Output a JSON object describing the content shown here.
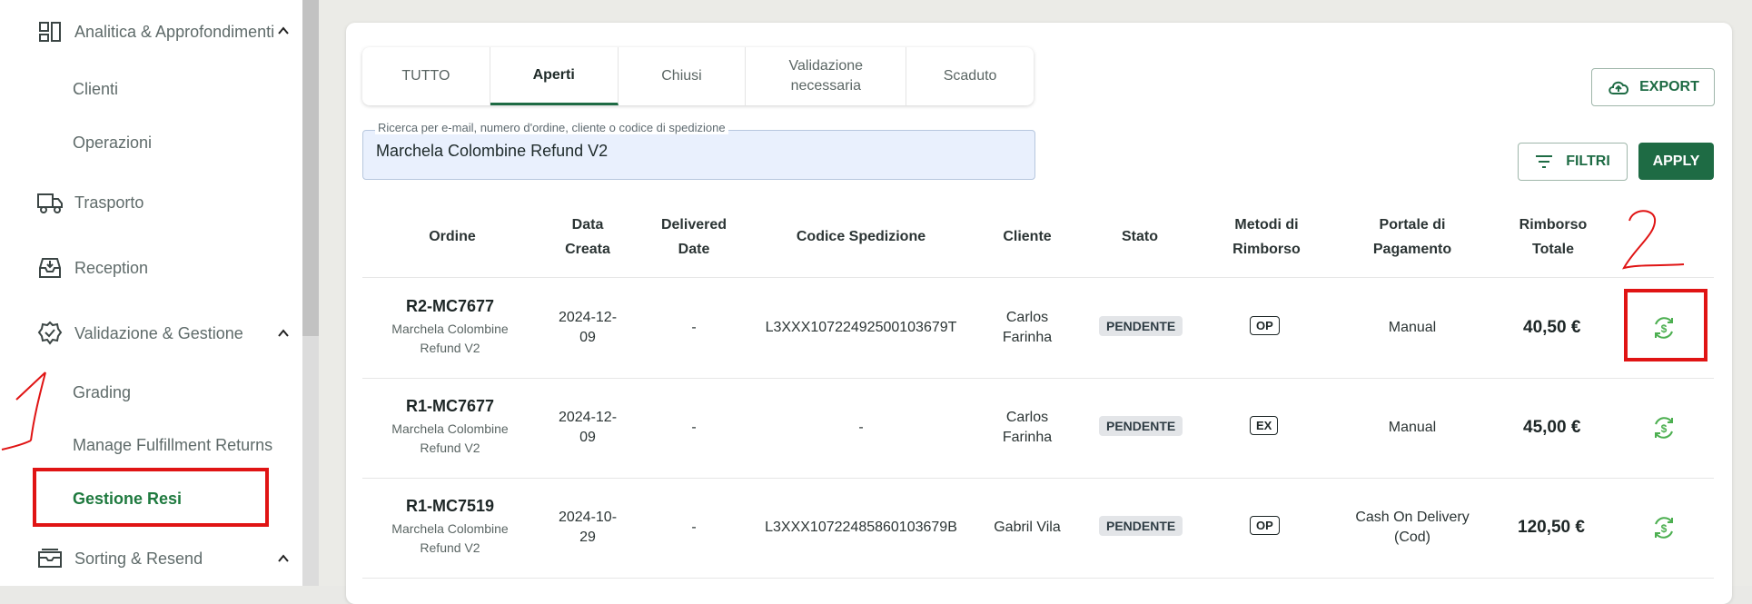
{
  "sidebar": {
    "items": [
      {
        "label": "Analitica & Approfondimenti",
        "icon": "analytics-icon"
      },
      {
        "label": "Clienti"
      },
      {
        "label": "Operazioni"
      },
      {
        "label": "Trasporto",
        "icon": "truck-icon"
      },
      {
        "label": "Reception",
        "icon": "inbox-icon"
      },
      {
        "label": "Validazione & Gestione",
        "icon": "check-badge-icon"
      },
      {
        "label": "Grading"
      },
      {
        "label": "Manage Fulfillment Returns"
      },
      {
        "label": "Gestione Resi"
      },
      {
        "label": "Sorting & Resend",
        "icon": "box-icon"
      }
    ]
  },
  "tabs": [
    {
      "label": "TUTTO"
    },
    {
      "label": "Aperti"
    },
    {
      "label": "Chiusi"
    },
    {
      "label": "Validazione necessaria"
    },
    {
      "label": "Scaduto"
    }
  ],
  "search": {
    "label": "Ricerca per e-mail, numero d'ordine, cliente o codice di spedizione",
    "value": "Marchela Colombine Refund V2"
  },
  "buttons": {
    "export": "EXPORT",
    "filtri": "FILTRI",
    "apply": "APPLY"
  },
  "table": {
    "headers": {
      "ordine": "Ordine",
      "data": "Data Creata",
      "delivered": "Delivered Date",
      "codice": "Codice Spedizione",
      "cliente": "Cliente",
      "stato": "Stato",
      "metodi": "Metodi di Rimborso",
      "portale": "Portale di Pagamento",
      "rimborso": "Rimborso Totale"
    },
    "rows": [
      {
        "order": "R2-MC7677",
        "sub": "Marchela Colombine Refund V2",
        "date1": "2024-12-",
        "date2": "09",
        "delivered": "-",
        "code": "L3XXX10722492500103679T",
        "client1": "Carlos",
        "client2": "Farinha",
        "status": "PENDENTE",
        "method": "OP",
        "portal1": "Manual",
        "portal2": "",
        "amount": "40,50 €"
      },
      {
        "order": "R1-MC7677",
        "sub": "Marchela Colombine Refund V2",
        "date1": "2024-12-",
        "date2": "09",
        "delivered": "-",
        "code": "-",
        "client1": "Carlos",
        "client2": "Farinha",
        "status": "PENDENTE",
        "method": "EX",
        "portal1": "Manual",
        "portal2": "",
        "amount": "45,00 €"
      },
      {
        "order": "R1-MC7519",
        "sub": "Marchela Colombine Refund V2",
        "date1": "2024-10-",
        "date2": "29",
        "delivered": "-",
        "code": "L3XXX10722485860103679B",
        "client1": "Gabril Vila",
        "client2": "",
        "status": "PENDENTE",
        "method": "OP",
        "portal1": "Cash On Delivery",
        "portal2": "(Cod)",
        "amount": "120,50 €"
      }
    ]
  },
  "colors": {
    "accent": "#1e6b44",
    "refund_icon": "#4caf50",
    "annotation": "#e01414"
  }
}
